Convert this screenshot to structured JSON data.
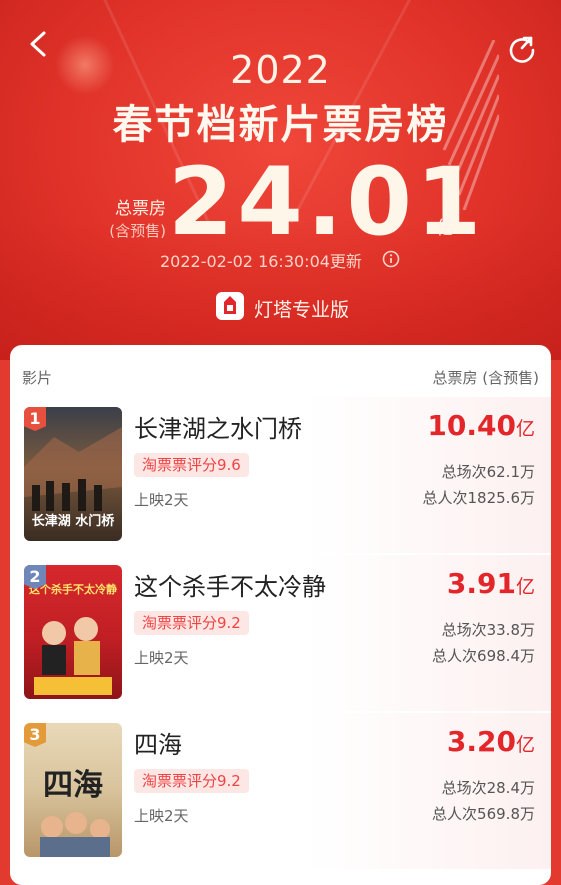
{
  "header": {
    "year": "2022",
    "title": "春节档新片票房榜",
    "total_label": "总票房",
    "total_sublabel": "(含预售)",
    "total_value": "24.01",
    "total_unit": "亿",
    "update_time": "2022-02-02 16:30:04更新",
    "brand_name": "灯塔专业版",
    "icons": {
      "back": "back-arrow-icon",
      "share": "share-icon",
      "info": "info-icon",
      "brand": "dengta-logo-icon"
    }
  },
  "table": {
    "col_left": "影片",
    "col_right": "总票房 (含预售)"
  },
  "movies": [
    {
      "rank": "1",
      "title": "长津湖之水门桥",
      "rating": "淘票票评分9.6",
      "days": "上映2天",
      "box_office": "10.40",
      "box_unit": "亿",
      "sessions": "总场次62.1万",
      "viewers": "总人次1825.6万",
      "poster_text": "长津湖 水门桥"
    },
    {
      "rank": "2",
      "title": "这个杀手不太冷静",
      "rating": "淘票票评分9.2",
      "days": "上映2天",
      "box_office": "3.91",
      "box_unit": "亿",
      "sessions": "总场次33.8万",
      "viewers": "总人次698.4万",
      "poster_text": "这个杀手不太冷静"
    },
    {
      "rank": "3",
      "title": "四海",
      "rating": "淘票票评分9.2",
      "days": "上映2天",
      "box_office": "3.20",
      "box_unit": "亿",
      "sessions": "总场次28.4万",
      "viewers": "总人次569.8万",
      "poster_text": "四海"
    }
  ],
  "colors": {
    "accent": "#e3262a",
    "hero": "#e03229",
    "rating_bg": "#fde7e5"
  }
}
